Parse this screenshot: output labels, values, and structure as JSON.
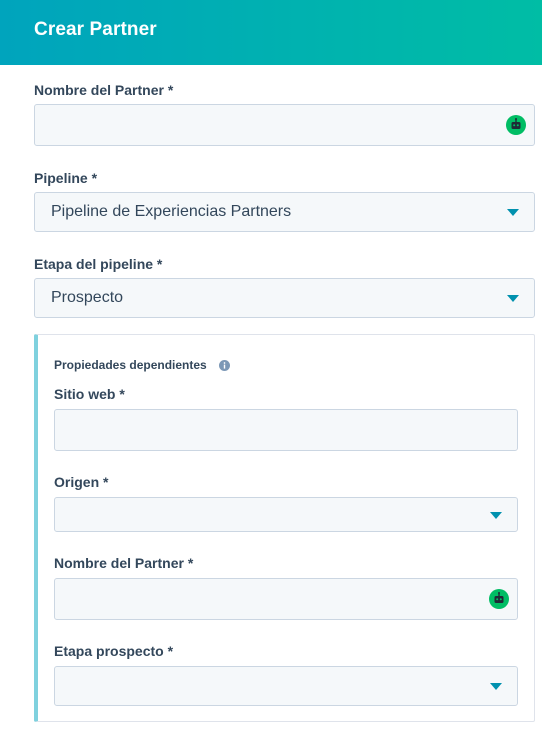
{
  "header": {
    "title": "Crear Partner"
  },
  "main": {
    "partner_name": {
      "label": "Nombre del Partner *",
      "value": "",
      "icon": "bot-icon"
    },
    "pipeline": {
      "label": "Pipeline *",
      "value": "Pipeline de Experiencias Partners",
      "icon": "caret-down-icon"
    },
    "stage": {
      "label": "Etapa del pipeline *",
      "value": "Prospecto",
      "icon": "caret-down-icon"
    }
  },
  "dependent": {
    "title": "Propiedades dependientes",
    "info_icon": "info-icon",
    "website": {
      "label": "Sitio web *",
      "value": ""
    },
    "origin": {
      "label": "Origen *",
      "value": ""
    },
    "partner_name": {
      "label": "Nombre del Partner *",
      "value": ""
    },
    "prospect_stage": {
      "label": "Etapa prospecto *",
      "value": ""
    }
  },
  "colors": {
    "header_gradient_start": "#00a4bd",
    "header_gradient_end": "#00bda5",
    "caret": "#0091ae",
    "bot_icon": "#00bd64",
    "card_accent": "#7fd1de"
  }
}
